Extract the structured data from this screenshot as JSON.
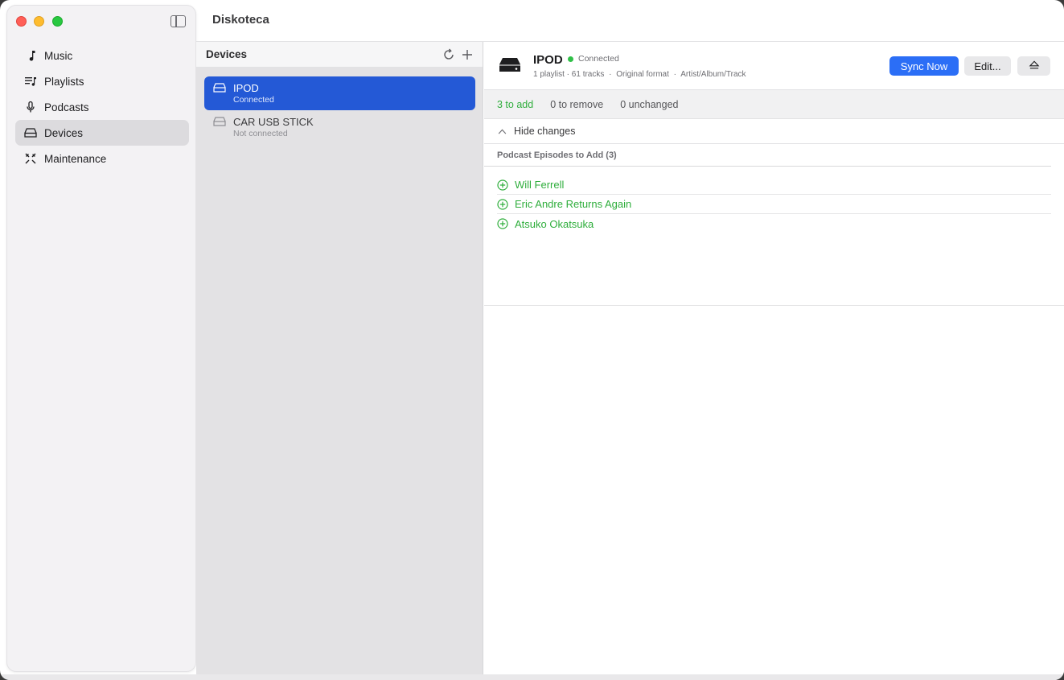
{
  "app": {
    "title": "Diskoteca"
  },
  "sidebar": {
    "items": [
      {
        "label": "Music",
        "icon": "music-note-icon",
        "active": false
      },
      {
        "label": "Playlists",
        "icon": "playlist-icon",
        "active": false
      },
      {
        "label": "Podcasts",
        "icon": "microphone-icon",
        "active": false
      },
      {
        "label": "Devices",
        "icon": "drive-icon",
        "active": true
      },
      {
        "label": "Maintenance",
        "icon": "tools-icon",
        "active": false
      }
    ]
  },
  "devices_list": {
    "header": "Devices",
    "devices": [
      {
        "name": "IPOD",
        "status": "Connected",
        "selected": true
      },
      {
        "name": "CAR USB STICK",
        "status": "Not connected",
        "selected": false
      }
    ]
  },
  "detail": {
    "device_name": "IPOD",
    "connection": "Connected",
    "meta": {
      "counts": "1 playlist · 61 tracks",
      "sep1": "·",
      "format": "Original format",
      "sep2": "·",
      "structure": "Artist/Album/Track"
    },
    "buttons": {
      "sync": "Sync Now",
      "edit": "Edit...",
      "eject": "eject-icon"
    },
    "summary": {
      "add": "3 to add",
      "remove": "0 to remove",
      "unchanged": "0 unchanged"
    },
    "toggle_label": "Hide changes",
    "section_title": "Podcast Episodes to Add (3)",
    "episodes": [
      "Will Ferrell",
      "Eric Andre Returns Again",
      "Atsuko Okatsuka"
    ]
  },
  "colors": {
    "accent": "#2b6ef6",
    "selection": "#2459d6",
    "add_green": "#2fae3c",
    "connected_dot": "#30c048"
  }
}
